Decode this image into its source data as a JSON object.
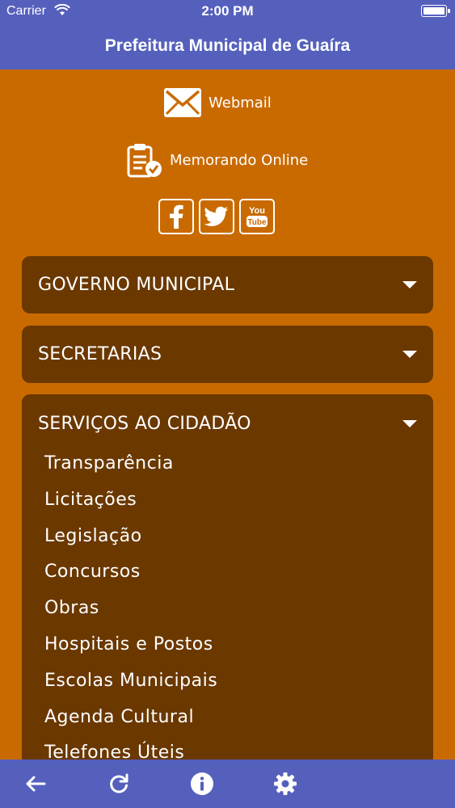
{
  "status_bar": {
    "carrier": "Carrier",
    "time": "2:00 PM"
  },
  "nav": {
    "title": "Prefeitura Municipal de Guaíra"
  },
  "quick_links": {
    "webmail": "Webmail",
    "memorando": "Memorando Online"
  },
  "social": {
    "youtube_top": "You",
    "youtube_bottom": "Tube"
  },
  "accordions": [
    {
      "title": "GOVERNO MUNICIPAL"
    },
    {
      "title": "SECRETARIAS"
    },
    {
      "title": "SERVIÇOS AO CIDADÃO",
      "items": [
        "Transparência",
        "Licitações",
        "Legislação",
        "Concursos",
        "Obras",
        "Hospitais e Postos",
        "Escolas Municipais",
        "Agenda Cultural",
        "Telefones Úteis"
      ]
    }
  ],
  "colors": {
    "bar": "#5560bd",
    "background": "#c96a00",
    "panel": "#6b3800"
  }
}
